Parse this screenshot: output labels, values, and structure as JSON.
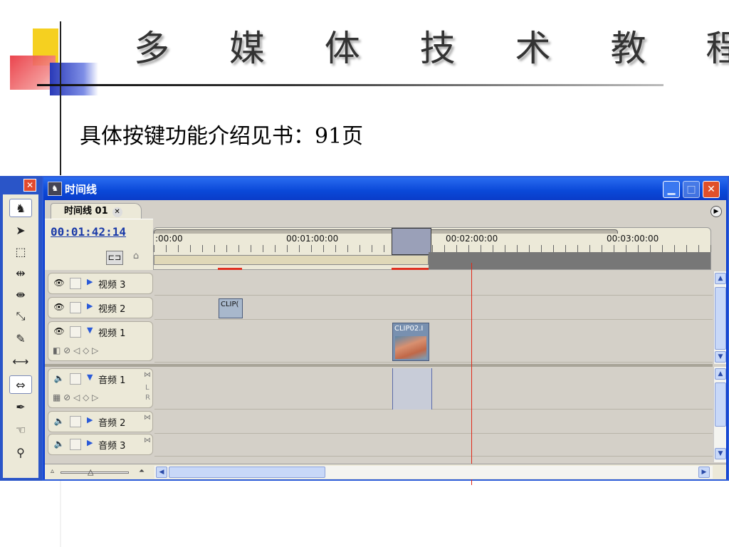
{
  "slide": {
    "title": "多 媒 体 技 术 教 程",
    "body": "具体按键功能介绍见书：91页"
  },
  "window": {
    "title": "时间线",
    "tab_label": "时间线 01",
    "timecode": "00:01:42:14",
    "ruler_labels": [
      ":00:00",
      "00:01:00:00",
      "00:02:00:00",
      "00:03:00:00"
    ]
  },
  "tracks": {
    "video3": "视频 3",
    "video2": "视频 2",
    "video1": "视频 1",
    "audio1": "音频 1",
    "audio2": "音频 2",
    "audio3": "音频 3"
  },
  "clips": {
    "clip_a": "CLIP(",
    "clip_b": "CLIP02.I"
  },
  "icons": {
    "toolbox": [
      "track-select-icon",
      "selection-icon",
      "range-select-icon",
      "ripple-edit-icon",
      "rolling-edit-icon",
      "rate-stretch-icon",
      "razor-icon",
      "slip-icon",
      "slide-icon",
      "pen-icon",
      "hand-icon",
      "zoom-icon"
    ]
  },
  "colors": {
    "title_bar": "#0a48d8",
    "playhead": "#e02818",
    "timecode": "#1a3aa8"
  }
}
